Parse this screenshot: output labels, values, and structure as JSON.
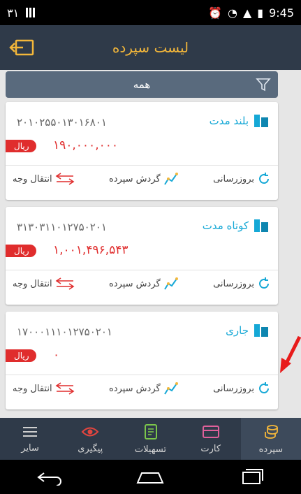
{
  "status_bar": {
    "left_text": "۳۱",
    "time": "9:45"
  },
  "header": {
    "title": "لیست سپرده"
  },
  "filter": {
    "label": "همه"
  },
  "cards": [
    {
      "type": "بلند مدت",
      "number": "۲۰۱۰۲۵۵۰۱۳۰۱۶۸۰۱",
      "currency": "ریال",
      "amount": "۱۹۰,۰۰۰,۰۰۰",
      "actions": {
        "refresh": "بروزرسانی",
        "turnover": "گردش سپرده",
        "transfer": "انتقال وجه"
      }
    },
    {
      "type": "کوتاه مدت",
      "number": "۳۱۳۰۳۱۱۰۱۲۷۵۰۲۰۱",
      "currency": "ریال",
      "amount": "۱,۰۰۱,۴۹۶,۵۴۳",
      "actions": {
        "refresh": "بروزرسانی",
        "turnover": "گردش سپرده",
        "transfer": "انتقال وجه"
      }
    },
    {
      "type": "جاری",
      "number": "۱۷۰۰۰۱۱۱۰۱۲۷۵۰۲۰۱",
      "currency": "ریال",
      "amount": "۰",
      "actions": {
        "refresh": "بروزرسانی",
        "turnover": "گردش سپرده",
        "transfer": "انتقال وجه"
      }
    }
  ],
  "bottom_nav": {
    "items": [
      "سپرده",
      "کارت",
      "تسهیلات",
      "پیگیری",
      "سایر"
    ]
  },
  "colors": {
    "appbar": "#2f3a49",
    "accent": "#f4b73a",
    "account_type": "#15a8d6",
    "amount": "#e02d2d"
  }
}
